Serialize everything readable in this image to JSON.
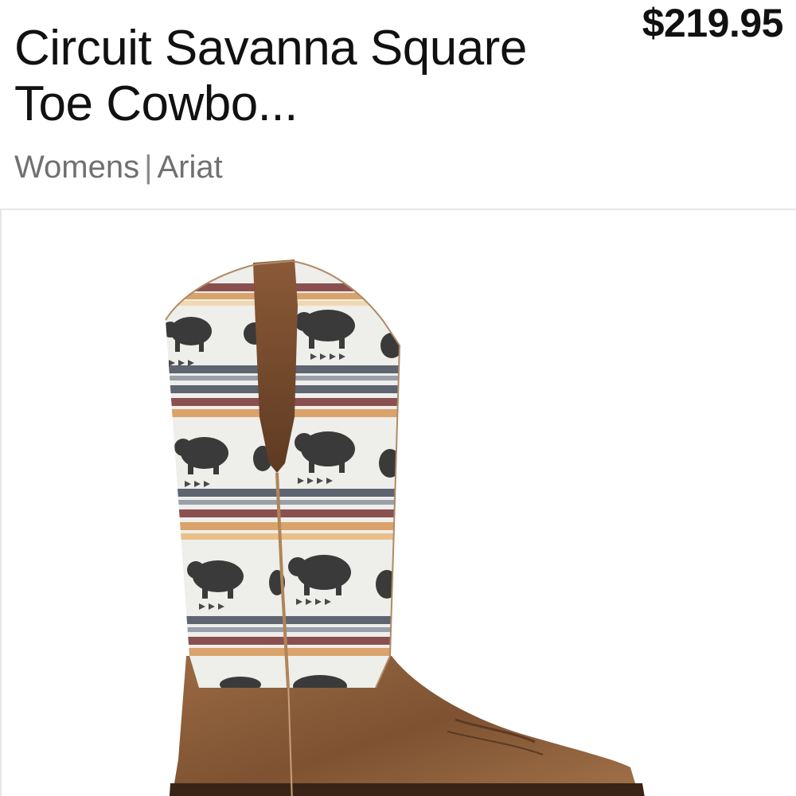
{
  "product": {
    "title": "Circuit Savanna Square Toe Cowbo...",
    "price": "$219.95",
    "category": "Womens",
    "separator": "|",
    "brand": "Ariat",
    "image_icon": "cowboy-boot-image"
  },
  "colors": {
    "text_primary": "#111111",
    "text_secondary": "#707070",
    "boot_leather": "#8a5a35",
    "boot_shaft_bg": "#eeeeea",
    "bison": "#3a3a3a",
    "stripe_brown": "#8a5050",
    "stripe_tan": "#d9a36b",
    "stripe_gray": "#5e6470"
  }
}
